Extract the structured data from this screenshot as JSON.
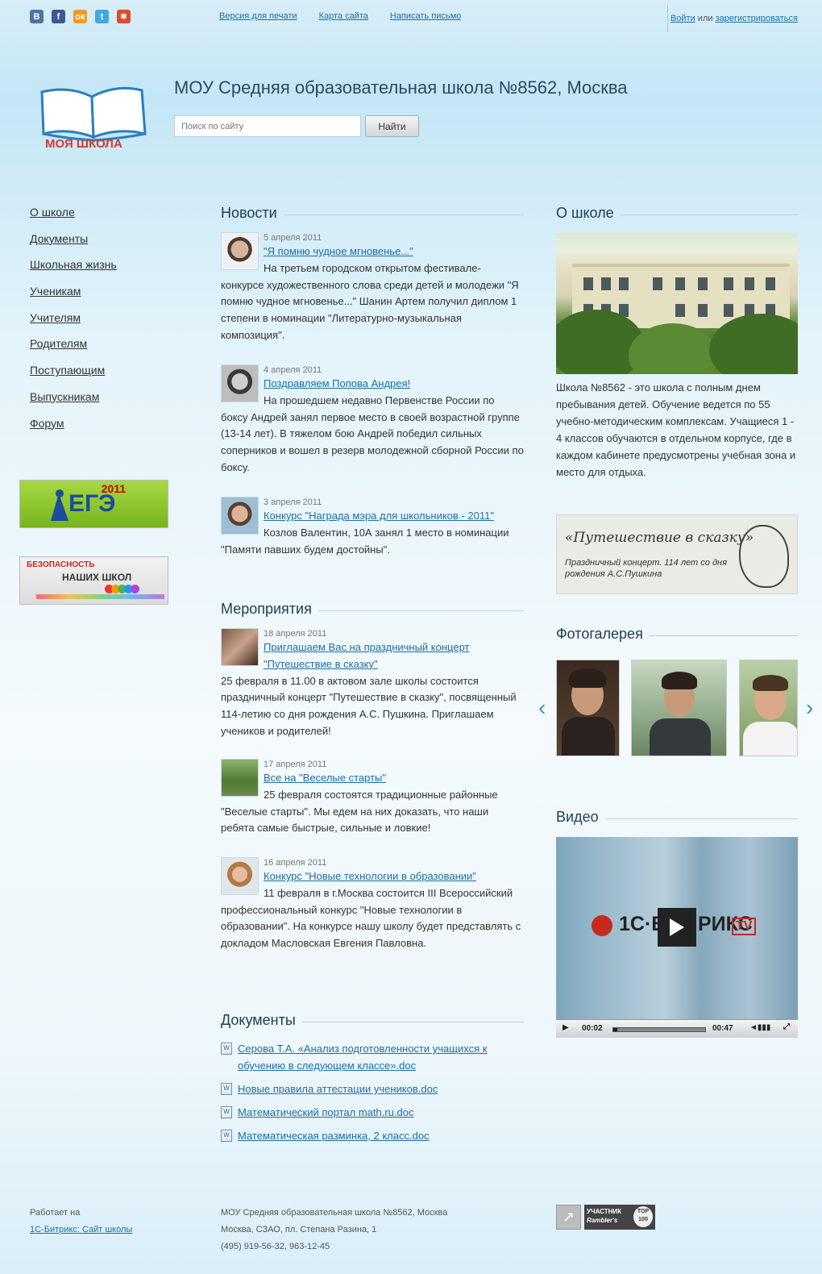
{
  "social": [
    {
      "icon": "vk-icon",
      "glyph": "В",
      "color": "#4f74a4"
    },
    {
      "icon": "facebook-icon",
      "glyph": "f",
      "color": "#3b5998"
    },
    {
      "icon": "odnoklassniki-icon",
      "glyph": "ок",
      "color": "#f59a1e"
    },
    {
      "icon": "twitter-icon",
      "glyph": "t",
      "color": "#3fa9e0"
    },
    {
      "icon": "livejournal-icon",
      "glyph": "✱",
      "color": "#e14a2d"
    }
  ],
  "toplinks": {
    "print": "Версия для печати",
    "sitemap": "Карта сайта",
    "write": "Написать письмо"
  },
  "auth": {
    "login": "Войти",
    "or": "или",
    "register": "зарегистрироваться"
  },
  "header": {
    "logo_text": "МОЯ ШКОЛА",
    "title": "МОУ Средняя образовательная школа №8562, Москва"
  },
  "search": {
    "placeholder": "Поиск по сайту",
    "button": "Найти"
  },
  "menu": [
    "О школе",
    "Документы",
    "Школьная жизнь",
    "Ученикам",
    "Учителям",
    "Родителям",
    "Поступающим",
    "Выпускникам",
    "Форум"
  ],
  "banners": {
    "ege_year": "2011",
    "ege_title": "ЕГЭ",
    "safety_line1": "БЕЗОПАСНОСТЬ",
    "safety_line2": "НАШИХ ШКОЛ"
  },
  "news": {
    "heading": "Новости",
    "items": [
      {
        "date": "5 апреля 2011",
        "title": "\"Я помню чудное мгновенье...\"",
        "text": "На третьем городском открытом фестивале-конкурсе художественного слова среди детей и молодежи \"Я помню чудное мгновенье...\" Шанин Артем получил диплом 1 степени в номинации \"Литературно-музыкальная композиция\"."
      },
      {
        "date": "4 апреля 2011",
        "title": "Поздравляем Попова Андрея!",
        "text": "На прошедшем недавно Первенстве России по боксу Андрей занял первое место в своей возрастной группе (13-14 лет). В тяжелом бою Андрей победил сильных соперников и вошел в резерв молодежной сборной России по боксу."
      },
      {
        "date": "3 апреля 2011",
        "title": "Конкурс \"Награда мэра для школьников - 2011\"",
        "text": "Козлов Валентин, 10А занял 1 место в номинации \"Памяти павших будем достойны\"."
      }
    ]
  },
  "events": {
    "heading": "Мероприятия",
    "items": [
      {
        "date": "18 апреля 2011",
        "title": "Приглашаем Вас на праздничный концерт \"Путешествие в сказку\"",
        "text": "25 февраля в 11.00 в актовом зале школы состоится праздничный концерт \"Путешествие в сказку\", посвященный 114-летию со дня рождения А.С. Пушкина. Приглашаем учеников и родителей!"
      },
      {
        "date": "17 апреля 2011",
        "title": "Все на \"Веселые старты\"",
        "text": "25 февраля состоятся традиционные районные \"Веселые старты\". Мы едем на них доказать, что наши ребята самые быстрые, сильные и ловкие!"
      },
      {
        "date": "16 апреля 2011",
        "title": "Конкурс \"Новые технологии в образовании\"",
        "text": "11 февраля в г.Москва состоится III Всероссийский профессиональный конкурс \"Новые технологии в образовании\". На конкурсе нашу школу будет представлять с докладом Масловская Евгения Павловна."
      }
    ]
  },
  "documents": {
    "heading": "Документы",
    "items": [
      "Серова Т.А. «Анализ подготовленности учащихся к обучению в следующем классе».doc",
      "Новые правила аттестации учеников.doc",
      "Математический портал math.ru.doc",
      "Математическая разминка, 2 класс.doc"
    ]
  },
  "about": {
    "heading": "О школе",
    "text": "Школа №8562 - это школа с полным днем пребывания детей. Обучение ведется по 55 учебно-методическим комплексам. Учащиеся 1 - 4 классов обучаются в отдельном корпусе, где в каждом кабинете предусмотрены учебная зона и место для отдыха."
  },
  "pushkin_banner": {
    "title": "«Путешествие в сказку»",
    "subtitle": "Праздничный концерт. 114 лет со дня рождения А.С.Пушкина"
  },
  "gallery": {
    "heading": "Фотогалерея"
  },
  "video": {
    "heading": "Видео",
    "brand": "1С·БИ",
    "brand2": "РИКС",
    "tv": "TV",
    "elapsed": "00:02",
    "duration": "00:47",
    "progress": 0.04
  },
  "footer": {
    "powered_label": "Работает на",
    "powered_link": "1С-Битрикс: Сайт школы",
    "org": "МОУ Средняя образовательная школа №8562, Москва",
    "address": "Москва, СЗАО, пл. Степана Разина, 1",
    "phone": "(495) 919-56-32, 963-12-45",
    "rambler_line1": "УЧАСТНИК",
    "rambler_line2": "Rambler's",
    "rambler_top": "TOP 100"
  }
}
